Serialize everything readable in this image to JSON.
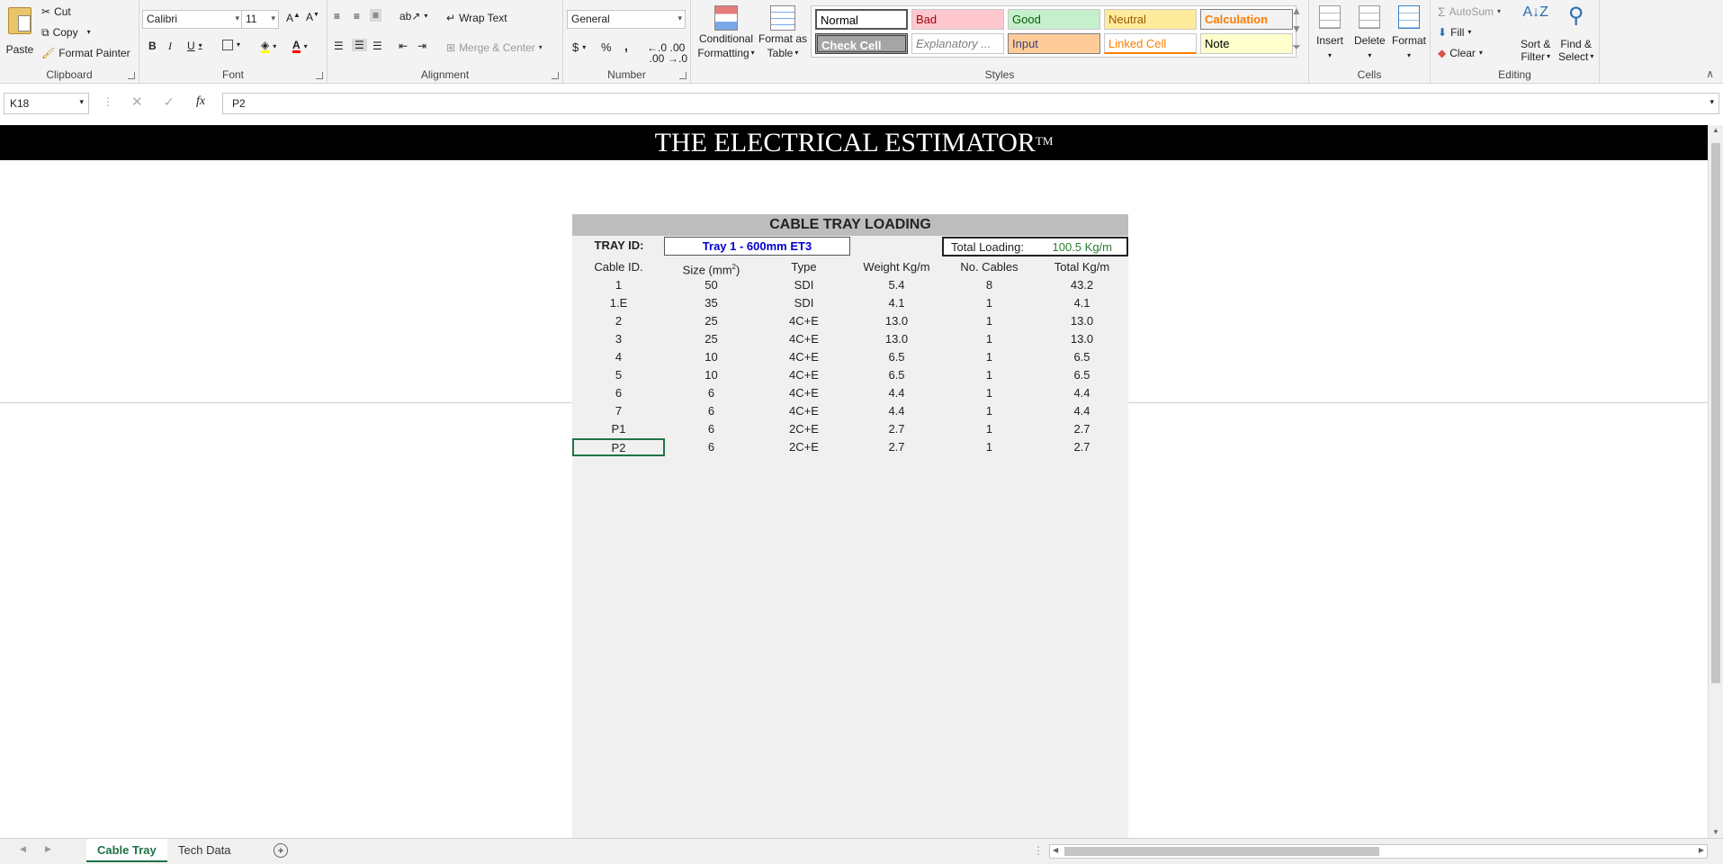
{
  "ribbon": {
    "clipboard": {
      "label": "Clipboard",
      "paste": "Paste",
      "cut": "Cut",
      "copy": "Copy",
      "format_painter": "Format Painter"
    },
    "font": {
      "label": "Font",
      "font_name": "Calibri",
      "font_size": "11",
      "bold": "B",
      "italic": "I",
      "underline": "U"
    },
    "alignment": {
      "label": "Alignment",
      "wrap_text": "Wrap Text",
      "merge_center": "Merge & Center"
    },
    "number": {
      "label": "Number",
      "format": "General",
      "currency": "$",
      "percent": "%",
      "comma": ","
    },
    "styles": {
      "label": "Styles",
      "conditional": "Conditional",
      "conditional2": "Formatting",
      "format_as": "Format as",
      "format_as2": "Table",
      "cells": [
        {
          "name": "Normal",
          "bg": "#ffffff",
          "fg": "#000000"
        },
        {
          "name": "Bad",
          "bg": "#ffc7ce",
          "fg": "#9c0006"
        },
        {
          "name": "Good",
          "bg": "#c6efce",
          "fg": "#006100"
        },
        {
          "name": "Neutral",
          "bg": "#ffeb9c",
          "fg": "#9c5700"
        },
        {
          "name": "Calculation",
          "bg": "#f2f2f2",
          "fg": "#fa7d00"
        },
        {
          "name": "Check Cell",
          "bg": "#a5a5a5",
          "fg": "#ffffff"
        },
        {
          "name": "Explanatory ...",
          "bg": "#ffffff",
          "fg": "#7f7f7f"
        },
        {
          "name": "Input",
          "bg": "#ffcc99",
          "fg": "#3f3f76"
        },
        {
          "name": "Linked Cell",
          "bg": "#ffffff",
          "fg": "#fa7d00"
        },
        {
          "name": "Note",
          "bg": "#ffffcc",
          "fg": "#000000"
        }
      ]
    },
    "cells": {
      "label": "Cells",
      "insert": "Insert",
      "delete": "Delete",
      "format": "Format"
    },
    "editing": {
      "label": "Editing",
      "autosum": "AutoSum",
      "fill": "Fill",
      "clear": "Clear",
      "sort": "Sort &",
      "sort2": "Filter",
      "find": "Find &",
      "find2": "Select"
    }
  },
  "formula_bar": {
    "name_box": "K18",
    "formula": "P2"
  },
  "sheet": {
    "banner_title": "THE ELECTRICAL ESTIMATOR",
    "banner_tm": "TM",
    "panel_title": "CABLE TRAY LOADING",
    "tray_id_label": "TRAY ID:",
    "tray_id_value": "Tray 1 - 600mm ET3",
    "total_loading_label": "Total Loading:",
    "total_loading_value": "100.5 Kg/m",
    "headers": [
      "Cable ID.",
      "Size (mm",
      "Type",
      "Weight Kg/m",
      "No. Cables",
      "Total Kg/m"
    ],
    "size_header_sup": "2",
    "selected_cell": "K18",
    "rows": [
      [
        "1",
        "50",
        "SDI",
        "5.4",
        "8",
        "43.2"
      ],
      [
        "1.E",
        "35",
        "SDI",
        "4.1",
        "1",
        "4.1"
      ],
      [
        "2",
        "25",
        "4C+E",
        "13.0",
        "1",
        "13.0"
      ],
      [
        "3",
        "25",
        "4C+E",
        "13.0",
        "1",
        "13.0"
      ],
      [
        "4",
        "10",
        "4C+E",
        "6.5",
        "1",
        "6.5"
      ],
      [
        "5",
        "10",
        "4C+E",
        "6.5",
        "1",
        "6.5"
      ],
      [
        "6",
        "6",
        "4C+E",
        "4.4",
        "1",
        "4.4"
      ],
      [
        "7",
        "6",
        "4C+E",
        "4.4",
        "1",
        "4.4"
      ],
      [
        "P1",
        "6",
        "2C+E",
        "2.7",
        "1",
        "2.7"
      ],
      [
        "P2",
        "6",
        "2C+E",
        "2.7",
        "1",
        "2.7"
      ]
    ]
  },
  "tabs": [
    {
      "label": "Cable Tray",
      "active": true
    },
    {
      "label": "Tech Data",
      "active": false
    }
  ],
  "colors": {
    "accent": "#1e7145",
    "tray_blue": "#0000cc",
    "total_green": "#2e7d32"
  }
}
